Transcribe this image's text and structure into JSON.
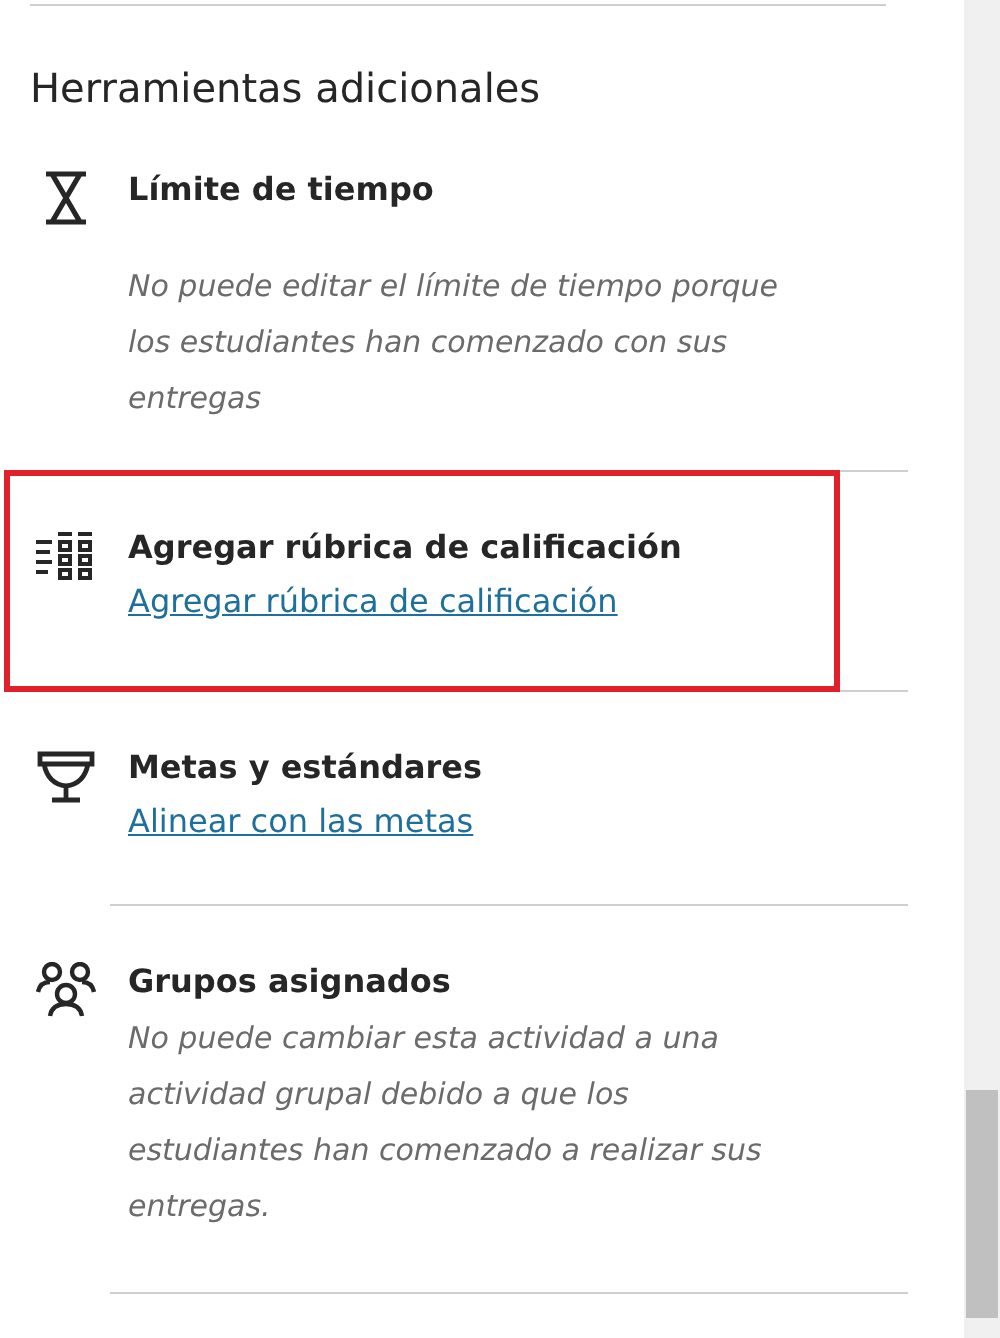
{
  "section": {
    "title": "Herramientas adicionales"
  },
  "items": [
    {
      "kind": "hourglass",
      "title": "Límite de tiempo",
      "note": "No puede editar el límite de tiempo porque los estudiantes han comenzado con sus entregas",
      "highlighted": false
    },
    {
      "kind": "rubric",
      "title": "Agregar rúbrica de calificación",
      "link": "Agregar rúbrica de calificación",
      "highlighted": true
    },
    {
      "kind": "trophy",
      "title": "Metas y estándares",
      "link": "Alinear con las metas",
      "highlighted": false
    },
    {
      "kind": "group",
      "title": "Grupos asignados",
      "note": "No puede cambiar esta actividad a una actividad grupal debido a que los estudiantes han comenzado a realizar sus entregas.",
      "highlighted": false
    }
  ]
}
